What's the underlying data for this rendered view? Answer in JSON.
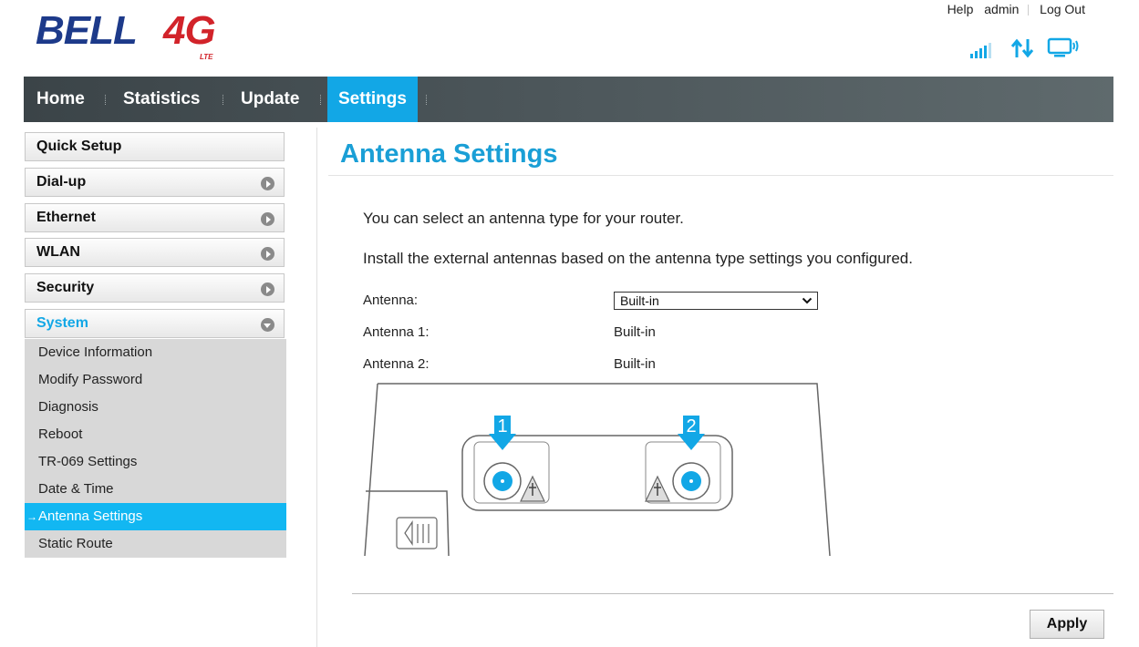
{
  "brand": {
    "name": "BELL",
    "suffix": "4G",
    "tag": "LTE"
  },
  "top_links": {
    "help": "Help",
    "user": "admin",
    "logout": "Log Out"
  },
  "status_icons": [
    "signal-strength-icon",
    "data-transfer-icon",
    "connected-device-icon"
  ],
  "nav": {
    "tabs": [
      {
        "label": "Home",
        "active": false
      },
      {
        "label": "Statistics",
        "active": false
      },
      {
        "label": "Update",
        "active": false
      },
      {
        "label": "Settings",
        "active": true
      }
    ]
  },
  "sidebar": {
    "items": [
      {
        "label": "Quick Setup",
        "expandable": false
      },
      {
        "label": "Dial-up",
        "expandable": true
      },
      {
        "label": "Ethernet",
        "expandable": true
      },
      {
        "label": "WLAN",
        "expandable": true
      },
      {
        "label": "Security",
        "expandable": true
      },
      {
        "label": "System",
        "expandable": true,
        "expanded": true
      }
    ],
    "system_submenu": [
      "Device Information",
      "Modify Password",
      "Diagnosis",
      "Reboot",
      "TR-069 Settings",
      "Date & Time",
      "Antenna Settings",
      "Static Route"
    ],
    "active_submenu": "Antenna Settings"
  },
  "main": {
    "title": "Antenna Settings",
    "description_1": "You can select an antenna type for your router.",
    "description_2": "Install the external antennas based on the antenna type settings you configured.",
    "fields": {
      "antenna_label": "Antenna:",
      "antenna_value": "Built-in",
      "antenna1_label": "Antenna 1:",
      "antenna1_value": "Built-in",
      "antenna2_label": "Antenna 2:",
      "antenna2_value": "Built-in"
    },
    "diagram": {
      "port1": "1",
      "port2": "2"
    },
    "apply_label": "Apply"
  },
  "colors": {
    "accent": "#12a7e6",
    "nav_bg": "#4d575b",
    "active_submenu": "#12b7f2",
    "title": "#1a9fd6"
  }
}
